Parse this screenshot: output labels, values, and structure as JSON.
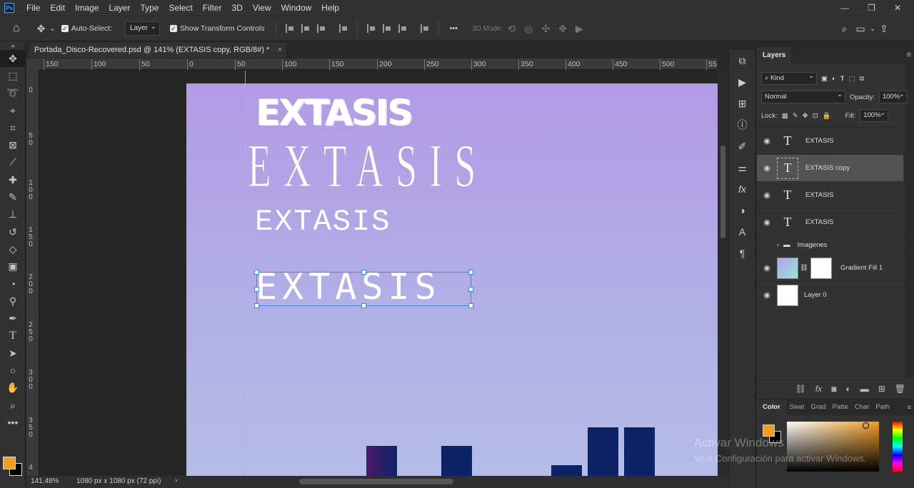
{
  "menu": [
    "File",
    "Edit",
    "Image",
    "Layer",
    "Type",
    "Select",
    "Filter",
    "3D",
    "View",
    "Window",
    "Help"
  ],
  "window_controls": [
    "—",
    "❐",
    "✕"
  ],
  "options": {
    "auto_select_label": "Auto-Select:",
    "auto_select_value": "Layer",
    "transform_label": "Show Transform Controls",
    "mode3d_label": "3D Mode:",
    "more": "•••"
  },
  "document": {
    "tab_title": "Portada_Disco-Recovered.psd @ 141% (EXTASIS copy, RGB/8#) *",
    "close": "×",
    "ruler_top": [
      "150",
      "100",
      "50",
      "0",
      "50",
      "100",
      "150",
      "200",
      "250",
      "300",
      "350",
      "400",
      "450",
      "500",
      "55"
    ],
    "ruler_left": [
      "0",
      "5\n0",
      "1\n0\n0",
      "1\n5\n0",
      "2\n0\n0",
      "2\n5\n0",
      "3\n0\n0",
      "3\n5\n0",
      "4"
    ],
    "texts": [
      "EXTASIS",
      "EXTASIS",
      "EXTASIS",
      "EXTASIS"
    ]
  },
  "status": {
    "zoom": "141.48%",
    "size": "1080 px x 1080 px (72 ppi)"
  },
  "layers_panel": {
    "title": "Layers",
    "filter_kind": "Kind",
    "blend_mode": "Normal",
    "opacity_label": "Opacity:",
    "opacity_value": "100%",
    "lock_label": "Lock:",
    "fill_label": "Fill:",
    "fill_value": "100%",
    "layers": [
      {
        "name": "EXTASIS",
        "kind": "text",
        "selected": false
      },
      {
        "name": "EXTASIS copy",
        "kind": "text",
        "selected": true
      },
      {
        "name": "EXTASIS",
        "kind": "text",
        "selected": false
      },
      {
        "name": "EXTASIS",
        "kind": "text",
        "selected": false
      },
      {
        "name": "Imagenes",
        "kind": "group",
        "selected": false
      },
      {
        "name": "Gradient Fill 1",
        "kind": "fill",
        "selected": false
      },
      {
        "name": "Layer 0",
        "kind": "pixel",
        "selected": false
      }
    ]
  },
  "color_panel": {
    "tabs": [
      "Color",
      "Swat",
      "Grad",
      "Patte",
      "Char",
      "Path"
    ],
    "foreground": "#f39c1f",
    "background": "#000000"
  },
  "watermark": {
    "line1": "Activar Windows",
    "line2": "Ve a Configuración para activar Windows."
  }
}
